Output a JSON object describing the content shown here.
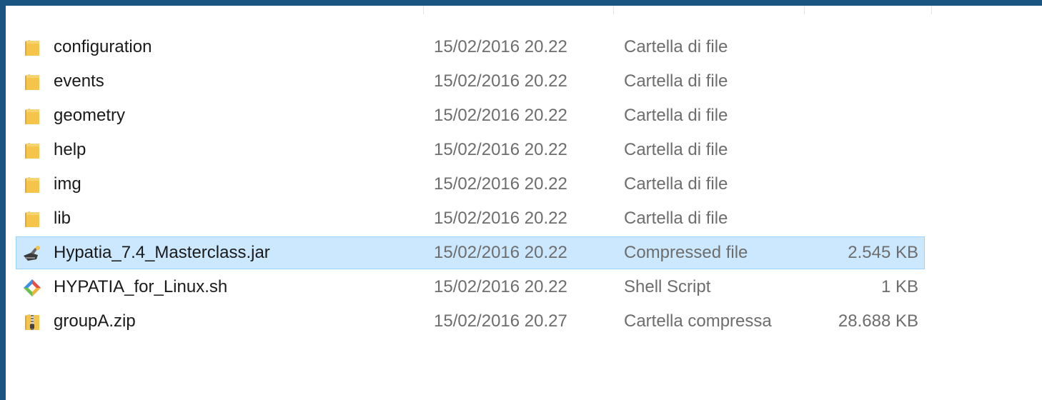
{
  "files": [
    {
      "name": "configuration",
      "date": "15/02/2016 20.22",
      "type": "Cartella di file",
      "size": "",
      "icon": "folder-icon",
      "selected": false
    },
    {
      "name": "events",
      "date": "15/02/2016 20.22",
      "type": "Cartella di file",
      "size": "",
      "icon": "folder-icon",
      "selected": false
    },
    {
      "name": "geometry",
      "date": "15/02/2016 20.22",
      "type": "Cartella di file",
      "size": "",
      "icon": "folder-icon",
      "selected": false
    },
    {
      "name": "help",
      "date": "15/02/2016 20.22",
      "type": "Cartella di file",
      "size": "",
      "icon": "folder-icon",
      "selected": false
    },
    {
      "name": "img",
      "date": "15/02/2016 20.22",
      "type": "Cartella di file",
      "size": "",
      "icon": "folder-icon",
      "selected": false
    },
    {
      "name": "lib",
      "date": "15/02/2016 20.22",
      "type": "Cartella di file",
      "size": "",
      "icon": "folder-icon",
      "selected": false
    },
    {
      "name": "Hypatia_7.4_Masterclass.jar",
      "date": "15/02/2016 20.22",
      "type": "Compressed file",
      "size": "2.545 KB",
      "icon": "jar-file-icon",
      "selected": true
    },
    {
      "name": "HYPATIA_for_Linux.sh",
      "date": "15/02/2016 20.22",
      "type": "Shell Script",
      "size": "1 KB",
      "icon": "shell-script-icon",
      "selected": false
    },
    {
      "name": "groupA.zip",
      "date": "15/02/2016 20.27",
      "type": "Cartella compressa",
      "size": "28.688 KB",
      "icon": "zip-folder-icon",
      "selected": false
    }
  ],
  "colors": {
    "selection_bg": "#cce8ff",
    "selection_border": "#99d1ff",
    "folder": "#f5c44a",
    "frame": "#1a5582"
  }
}
